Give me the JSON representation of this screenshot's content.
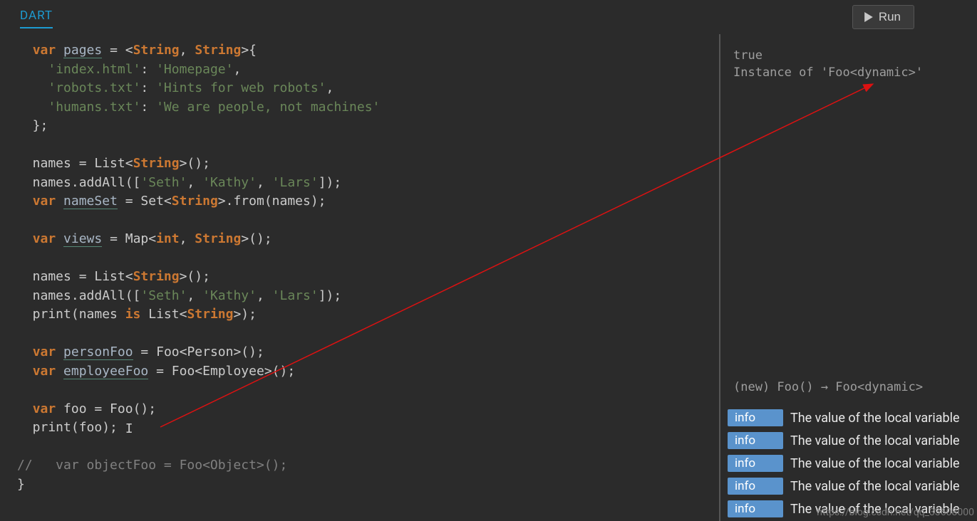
{
  "header": {
    "language_label": "DART",
    "run_label": "Run"
  },
  "code": {
    "l1": "  var pages = <String, String>{",
    "l2a": "    ",
    "l2k": "'index.html'",
    "l2c": ": ",
    "l2v": "'Homepage'",
    "l2e": ",",
    "l3a": "    ",
    "l3k": "'robots.txt'",
    "l3c": ": ",
    "l3v": "'Hints for web robots'",
    "l3e": ",",
    "l4a": "    ",
    "l4k": "'humans.txt'",
    "l4c": ": ",
    "l4v": "'We are people, not machines'",
    "l5": "  };",
    "l7a": "  names = List<",
    "l7b": "String",
    "l7c": ">();",
    "l8a": "  names.addAll([",
    "l8s1": "'Seth'",
    "l8c1": ", ",
    "l8s2": "'Kathy'",
    "l8c2": ", ",
    "l8s3": "'Lars'",
    "l8e": "]);",
    "l9a": "  ",
    "l9kw": "var",
    "l9b": " ",
    "l9n": "nameSet",
    "l9c": " = Set<",
    "l9d": "String",
    "l9e": ">.from(names);",
    "l11a": "  ",
    "l11kw": "var",
    "l11b": " ",
    "l11n": "views",
    "l11c": " = Map<",
    "l11d": "int",
    "l11e": ", ",
    "l11f": "String",
    "l11g": ">();",
    "l13a": "  names = List<",
    "l13b": "String",
    "l13c": ">();",
    "l14a": "  names.addAll([",
    "l14s1": "'Seth'",
    "l14c1": ", ",
    "l14s2": "'Kathy'",
    "l14c2": ", ",
    "l14s3": "'Lars'",
    "l14e": "]);",
    "l15a": "  print(names ",
    "l15kw": "is",
    "l15b": " List<",
    "l15c": "String",
    "l15d": ">);",
    "l17a": "  ",
    "l17kw": "var",
    "l17b": " ",
    "l17n": "personFoo",
    "l17c": " = Foo<Person>();",
    "l18a": "  ",
    "l18kw": "var",
    "l18b": " ",
    "l18n": "employeeFoo",
    "l18c": " = Foo<Employee>();",
    "l20a": "  ",
    "l20kw": "var",
    "l20b": " foo = Foo();",
    "l21": "  print(foo);",
    "l23": "//   var objectFoo = Foo<Object>();",
    "l24": "}"
  },
  "console": {
    "line1": "true",
    "line2": "Instance of 'Foo<dynamic>'"
  },
  "doc": "(new) Foo() → Foo<dynamic>",
  "diagnostics": {
    "badge": "info",
    "message": "The value of the local variable",
    "rows": [
      0,
      1,
      2,
      3,
      4
    ]
  },
  "watermark": "https://blog.csdn.net/qq_33608000"
}
